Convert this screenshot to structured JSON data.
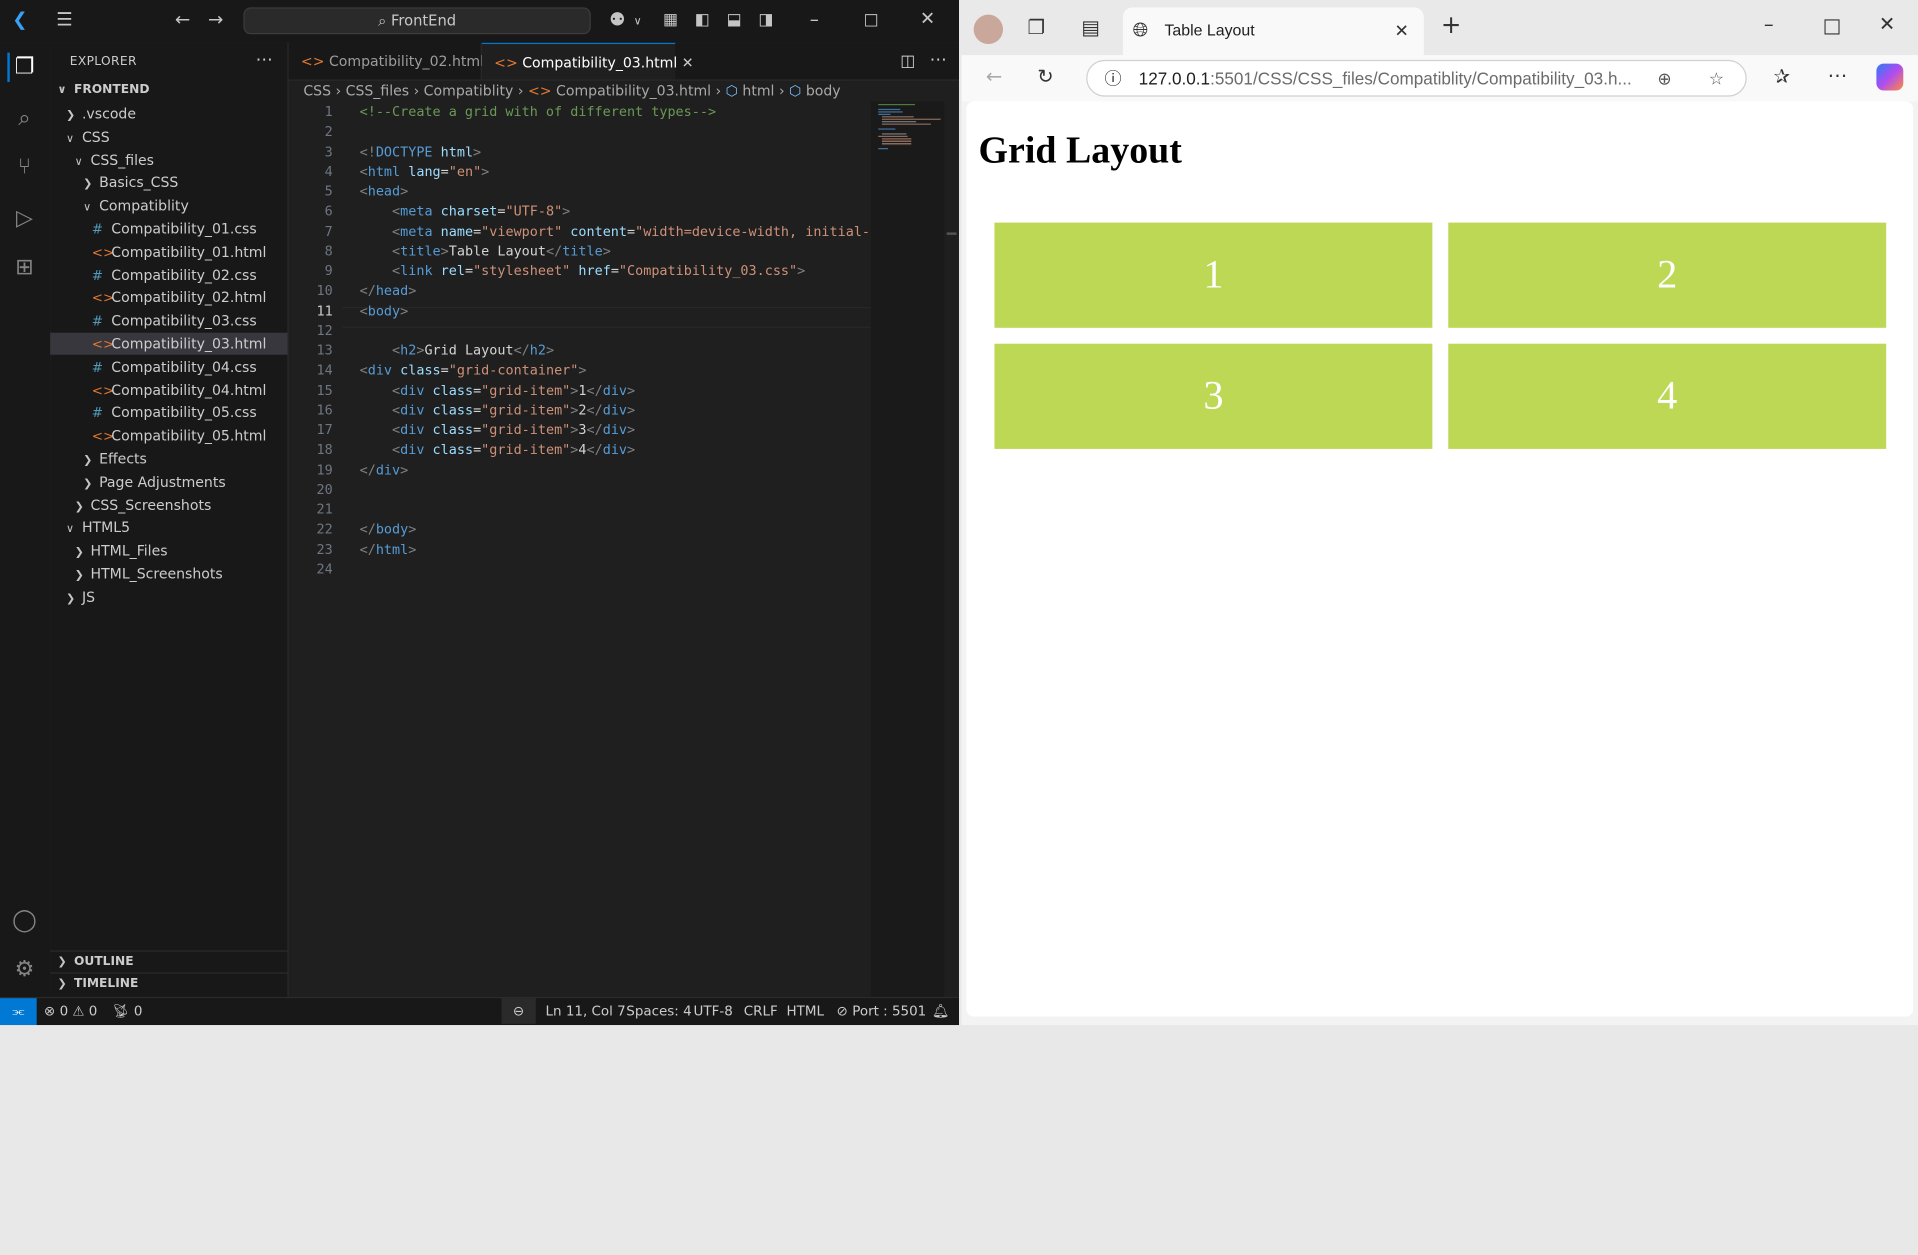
{
  "vscode": {
    "search_text": "FrontEnd",
    "explorer_title": "EXPLORER",
    "root_folder": "FRONTEND",
    "tree": [
      {
        "label": ".vscode",
        "type": "folder",
        "state": "closed"
      },
      {
        "label": "CSS",
        "type": "folder",
        "state": "open"
      },
      {
        "label": "CSS_files",
        "type": "folder",
        "state": "open"
      },
      {
        "label": "Basics_CSS",
        "type": "folder",
        "state": "closed"
      },
      {
        "label": "Compatiblity",
        "type": "folder",
        "state": "open"
      },
      {
        "label": "Compatibility_01.css",
        "type": "css"
      },
      {
        "label": "Compatibility_01.html",
        "type": "html"
      },
      {
        "label": "Compatibility_02.css",
        "type": "css"
      },
      {
        "label": "Compatibility_02.html",
        "type": "html"
      },
      {
        "label": "Compatibility_03.css",
        "type": "css"
      },
      {
        "label": "Compatibility_03.html",
        "type": "html",
        "selected": true
      },
      {
        "label": "Compatibility_04.css",
        "type": "css"
      },
      {
        "label": "Compatibility_04.html",
        "type": "html"
      },
      {
        "label": "Compatibility_05.css",
        "type": "css"
      },
      {
        "label": "Compatibility_05.html",
        "type": "html"
      },
      {
        "label": "Effects",
        "type": "folder",
        "state": "closed"
      },
      {
        "label": "Page Adjustments",
        "type": "folder",
        "state": "closed"
      },
      {
        "label": "CSS_Screenshots",
        "type": "folder",
        "state": "closed"
      },
      {
        "label": "HTML5",
        "type": "folder",
        "state": "open"
      },
      {
        "label": "HTML_Files",
        "type": "folder",
        "state": "closed"
      },
      {
        "label": "HTML_Screenshots",
        "type": "folder",
        "state": "closed"
      },
      {
        "label": "JS",
        "type": "folder",
        "state": "closed"
      }
    ],
    "outline_label": "OUTLINE",
    "timeline_label": "TIMELINE",
    "tabs": [
      {
        "label": "Compatibility_02.html",
        "active": false
      },
      {
        "label": "Compatibility_03.html",
        "active": true
      }
    ],
    "breadcrumb": [
      "CSS",
      "CSS_files",
      "Compatiblity",
      "Compatibility_03.html",
      "html",
      "body"
    ],
    "current_line": 11,
    "code_lines": [
      "<!--Create a grid with of different types-->",
      "",
      "<!DOCTYPE html>",
      "<html lang=\"en\">",
      "<head>",
      "    <meta charset=\"UTF-8\">",
      "    <meta name=\"viewport\" content=\"width=device-width, initial-s",
      "    <title>Table Layout</title>",
      "    <link rel=\"stylesheet\" href=\"Compatibility_03.css\">",
      "</head>",
      "<body>",
      "",
      "    <h2>Grid Layout</h2>",
      "<div class=\"grid-container\">",
      "    <div class=\"grid-item\">1</div>",
      "    <div class=\"grid-item\">2</div>",
      "    <div class=\"grid-item\">3</div>",
      "    <div class=\"grid-item\">4</div>",
      "</div>",
      "",
      "",
      "</body>",
      "</html>",
      ""
    ],
    "status": {
      "errors": "0",
      "warnings": "0",
      "ports": "0",
      "position": "Ln 11, Col 7",
      "spaces": "Spaces: 4",
      "encoding": "UTF-8",
      "eol": "CRLF",
      "language": "HTML",
      "port": "Port : 5501"
    }
  },
  "browser": {
    "tab_title": "Table Layout",
    "url_host": "127.0.0.1",
    "url_rest": ":5501/CSS/CSS_files/Compatiblity/Compatibility_03.h...",
    "page_heading": "Grid Layout",
    "grid_items": [
      "1",
      "2",
      "3",
      "4"
    ],
    "grid_color": "#bcd854"
  }
}
